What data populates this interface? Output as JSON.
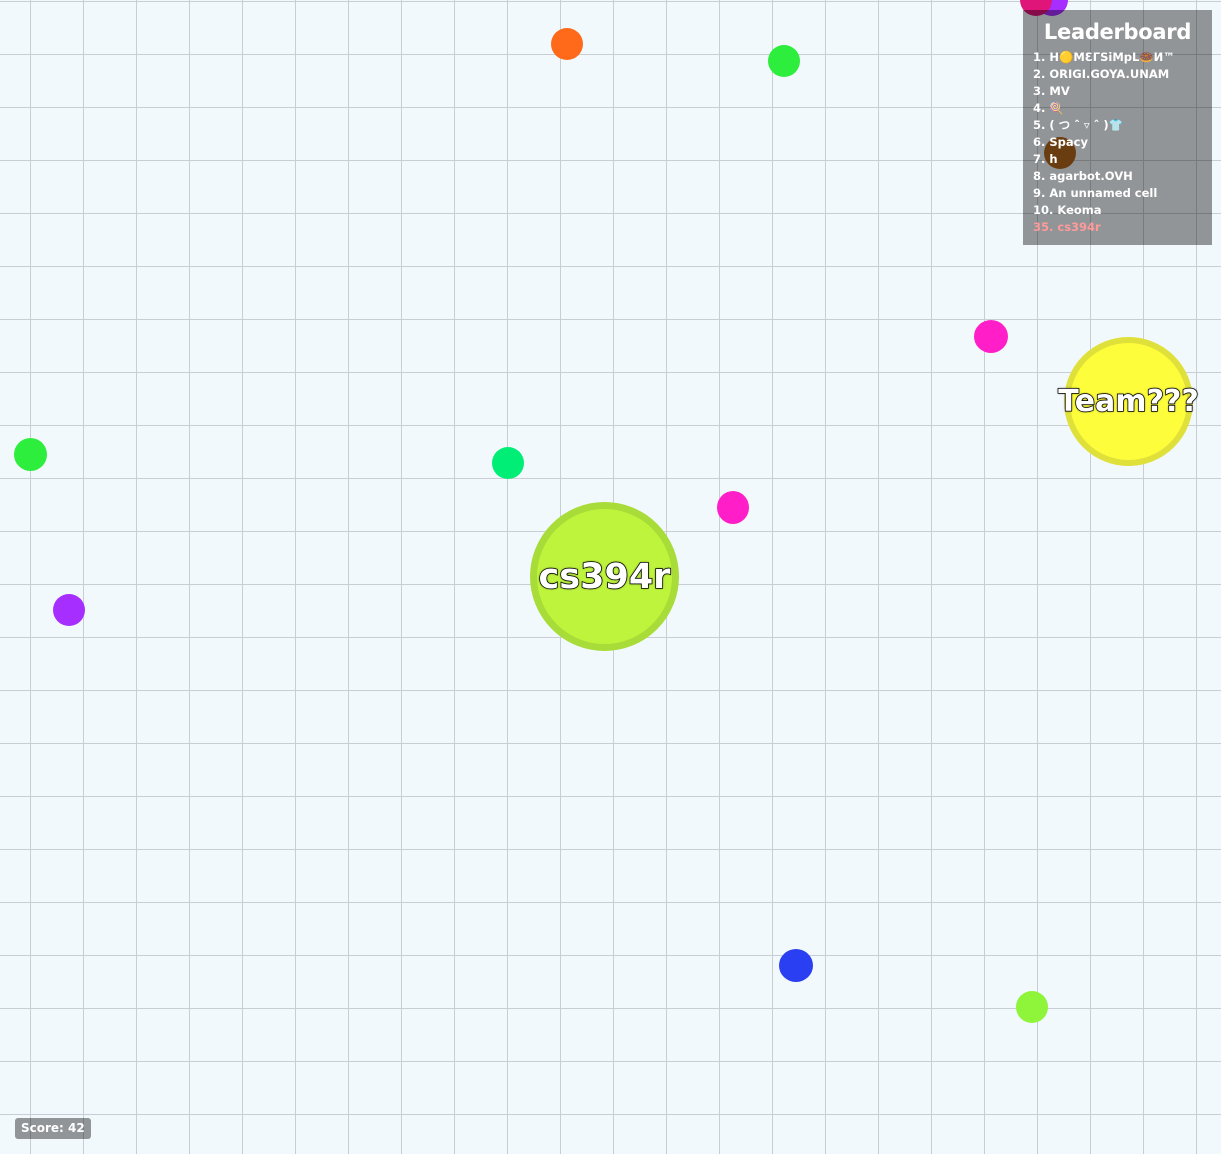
{
  "leaderboard": {
    "title": "Leaderboard",
    "entries": [
      "1. H🟡MƐГSiMpL🍩И™",
      "2. ORIGI.GOYA.UNAM",
      "3. MV",
      "4. 🍭",
      "5. ( つ ˆ ▿ ˆ )👕",
      "6. Spacy",
      "7. h",
      "8. agarbot.OVH",
      "9. An unnamed cell",
      "10. Keoma"
    ],
    "player_rank": "35. cs394r"
  },
  "player": {
    "name": "cs394r",
    "color": "#bef43c",
    "border": "#a8dc38"
  },
  "other_player": {
    "name": "Team???",
    "color": "#fdfd3c",
    "border": "#e0e03a"
  },
  "score": {
    "label": "Score: 42"
  },
  "colors": {
    "background": "#f2f9fd",
    "grid": "#c8ced3",
    "food_orange": "#ff6a1a",
    "food_green": "#2dee3c",
    "food_teal": "#00ee76",
    "food_magenta": "#ff1ec8",
    "food_purple": "#a62eff",
    "food_blue": "#2a3ef2",
    "food_lime": "#8ef53a",
    "food_brown": "#b0661c",
    "food_crimson": "#e0157a"
  }
}
